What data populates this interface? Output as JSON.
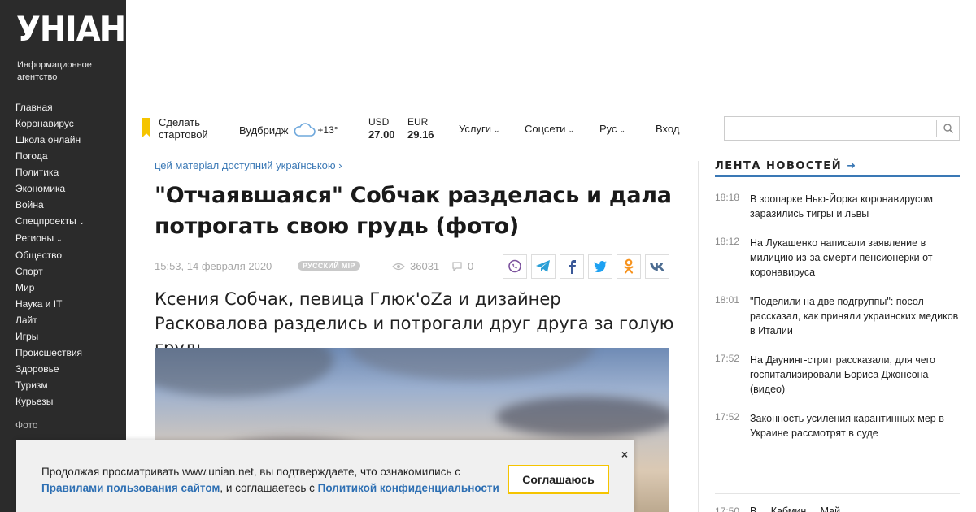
{
  "sidebar": {
    "logo": "УНІАН",
    "tagline": "Информационное агентство",
    "items": [
      {
        "label": "Главная"
      },
      {
        "label": "Коронавирус"
      },
      {
        "label": "Школа онлайн"
      },
      {
        "label": "Погода"
      },
      {
        "label": "Политика"
      },
      {
        "label": "Экономика"
      },
      {
        "label": "Война"
      },
      {
        "label": "Спецпроекты",
        "chevron": true
      },
      {
        "label": "Регионы",
        "chevron": true
      },
      {
        "label": "Общество"
      },
      {
        "label": "Спорт"
      },
      {
        "label": "Мир"
      },
      {
        "label": "Наука и IT"
      },
      {
        "label": "Лайт"
      },
      {
        "label": "Игры"
      },
      {
        "label": "Происшествия"
      },
      {
        "label": "Здоровье"
      },
      {
        "label": "Туризм"
      },
      {
        "label": "Курьезы"
      }
    ],
    "foto_label": "Фото"
  },
  "topbar": {
    "make_start_line1": "Сделать",
    "make_start_line2": "стартовой",
    "weather_city": "Вудбридж",
    "weather_temp": "+13°",
    "usd_label": "USD",
    "usd_value": "27.00",
    "eur_label": "EUR",
    "eur_value": "29.16",
    "services": "Услуги",
    "social": "Соцсети",
    "lang": "Рус",
    "login": "Вход",
    "search_placeholder": ""
  },
  "article": {
    "lang_link": "цей матеріал доступний українською",
    "title": "\"Отчаявшаяся\" Собчак разделась и дала потрогать свою грудь (фото)",
    "date": "15:53, 14 февраля 2020",
    "tag": "Русский мір",
    "views": "36031",
    "comments": "0",
    "lead": "Ксения Собчак, певица Глюк'oZa и дизайнер Расковалова разделись и потрогали друг друга за голую грудь."
  },
  "share": [
    "viber-icon",
    "telegram-icon",
    "facebook-icon",
    "twitter-icon",
    "odnoklassniki-icon",
    "vk-icon"
  ],
  "feed": {
    "heading": "ЛЕНТА НОВОСТЕЙ",
    "items": [
      {
        "time": "18:18",
        "title": "В зоопарке Нью-Йорка коронавирусом заразились тигры и львы"
      },
      {
        "time": "18:12",
        "title": "На Лукашенко написали заявление в милицию из-за смерти пенсионерки от коронавируса"
      },
      {
        "time": "18:01",
        "title": "\"Поделили на две подгруппы\": посол рассказал, как приняли украинских медиков в Италии"
      },
      {
        "time": "17:52",
        "title": "На Даунинг-стрит рассказали, для чего госпитализировали Бориса Джонсона (видео)"
      },
      {
        "time": "17:52",
        "title": "Законность усиления карантинных мер в Украине рассмотрят в суде"
      }
    ],
    "cut_time": "17:50",
    "cut_title": "В ... Кабмин ... Май..."
  },
  "cookie": {
    "text1": "Продолжая просматривать www.unian.net, вы подтверждаете, что ознакомились с ",
    "link1": "Правилами пользования сайтом",
    "text2": ", и соглашаетесь с ",
    "link2": "Политикой конфиденциальности",
    "button": "Соглашаюсь",
    "close": "×"
  },
  "colors": {
    "sidebar_bg": "#2b2b2b",
    "accent_blue": "#3a78b5",
    "accent_yellow": "#f5c400"
  }
}
